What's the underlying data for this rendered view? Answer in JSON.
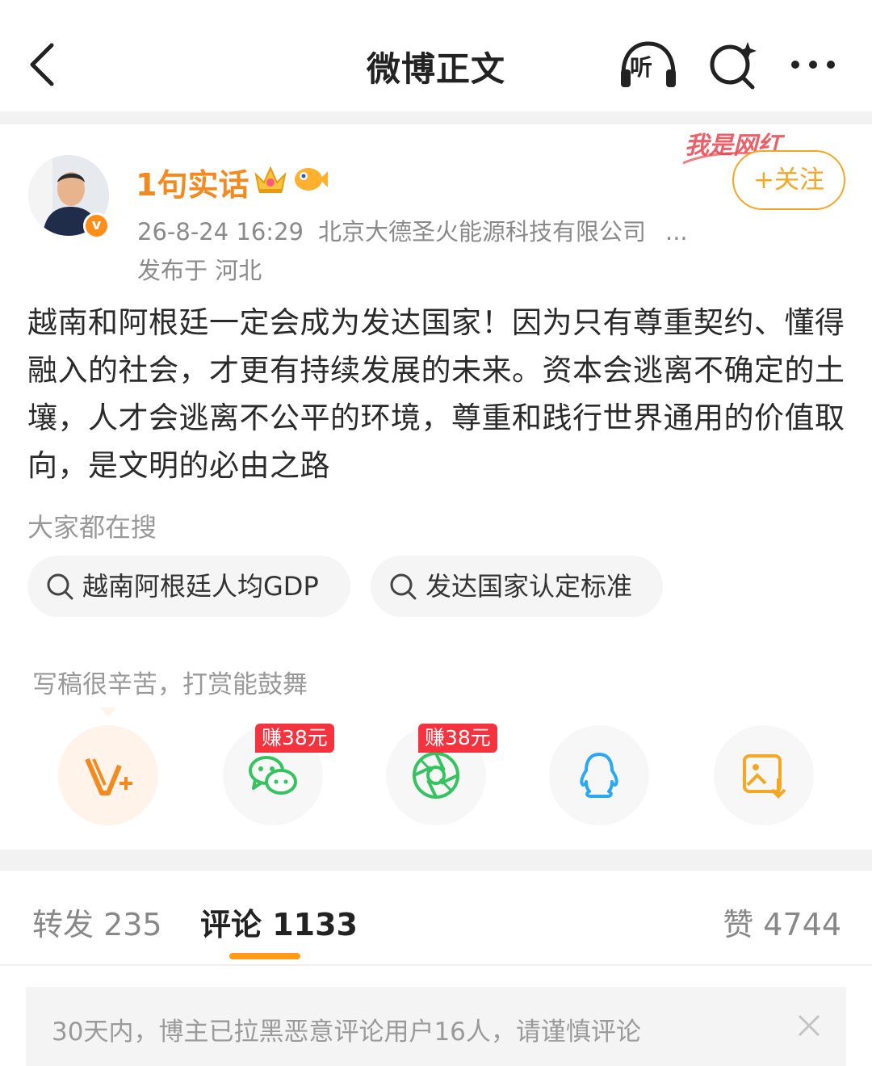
{
  "header": {
    "title": "微博正文",
    "listen_label": "听"
  },
  "post": {
    "author": "1句实话",
    "verified_mark": "v",
    "time": "26-8-24 16:29",
    "source": "北京大德圣火能源科技有限公司",
    "source_more": "...",
    "location": "发布于 河北",
    "follow_label": "+关注",
    "content": "越南和阿根廷一定会成为发达国家！因为只有尊重契约、懂得融入的社会，才更有持续发展的未来。资本会逃离不确定的土壤，人才会逃离不公平的环境，尊重和践行世界通用的价值取向，是文明的必由之路",
    "watermark": "我是网红"
  },
  "hot_search": {
    "label": "大家都在搜",
    "chips": [
      "越南阿根廷人均GDP",
      "发达国家认定标准"
    ]
  },
  "reward": {
    "label": "写稿很辛苦，打赏能鼓舞",
    "share_icons": [
      "v-plus-icon",
      "wechat-icon",
      "moments-icon",
      "qq-icon",
      "save-image-icon"
    ],
    "earn_badges": [
      "赚38元",
      "赚38元"
    ]
  },
  "tabs": {
    "repost": "转发 235",
    "comment": "评论 1133",
    "like": "赞 4744"
  },
  "notice": {
    "text": "30天内，博主已拉黑恶意评论用户16人，请谨慎评论"
  },
  "colors": {
    "accent_orange": "#f28a1f",
    "follow_border": "#f5a623",
    "tab_underline": "#ff9b1a",
    "earn_badge": "#f5333f"
  }
}
